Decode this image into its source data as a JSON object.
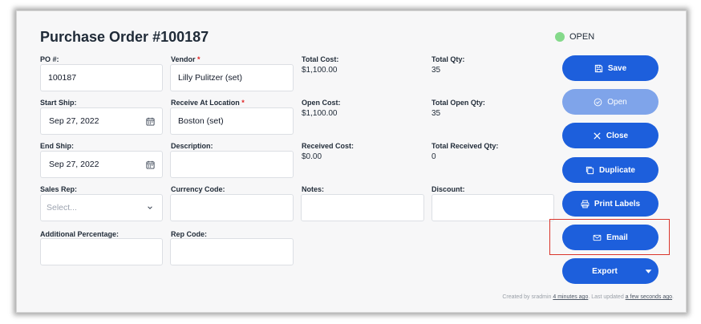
{
  "title": "Purchase Order #100187",
  "status": {
    "label": "OPEN",
    "color": "#84d98a"
  },
  "fields": {
    "po": {
      "label": "PO #:",
      "value": "100187"
    },
    "vendor": {
      "label": "Vendor",
      "required": "*",
      "value": "Lilly Pulitzer  (set)"
    },
    "start_ship": {
      "label": "Start Ship:",
      "value": "Sep 27, 2022"
    },
    "receive_at": {
      "label": "Receive At Location",
      "required": "*",
      "value": "Boston  (set)"
    },
    "end_ship": {
      "label": "End Ship:",
      "value": "Sep 27, 2022"
    },
    "description": {
      "label": "Description:",
      "value": ""
    },
    "sales_rep": {
      "label": "Sales Rep:",
      "placeholder": "Select..."
    },
    "currency_code": {
      "label": "Currency Code:",
      "value": ""
    },
    "notes": {
      "label": "Notes:",
      "value": ""
    },
    "discount": {
      "label": "Discount:",
      "value": ""
    },
    "additional_percentage": {
      "label": "Additional Percentage:",
      "value": ""
    },
    "rep_code": {
      "label": "Rep Code:",
      "value": ""
    }
  },
  "summary": {
    "total_cost": {
      "label": "Total Cost:",
      "value": "$1,100.00"
    },
    "total_qty": {
      "label": "Total Qty:",
      "value": "35"
    },
    "open_cost": {
      "label": "Open Cost:",
      "value": "$1,100.00"
    },
    "total_open_qty": {
      "label": "Total Open Qty:",
      "value": "35"
    },
    "received_cost": {
      "label": "Received Cost:",
      "value": "$0.00"
    },
    "total_received_qty": {
      "label": "Total Received Qty:",
      "value": "0"
    }
  },
  "actions": {
    "save": "Save",
    "open": "Open",
    "close": "Close",
    "duplicate": "Duplicate",
    "print_labels": "Print Labels",
    "email": "Email",
    "export": "Export"
  },
  "footer": {
    "created_prefix": "Created by sradmin",
    "created_ago": "4 minutes ago",
    "updated_prefix": "Last updated",
    "updated_ago": "a few seconds ago"
  },
  "colors": {
    "primary": "#1d5fdc",
    "primary_disabled": "#7fa4ea",
    "highlight": "#d9342b"
  }
}
